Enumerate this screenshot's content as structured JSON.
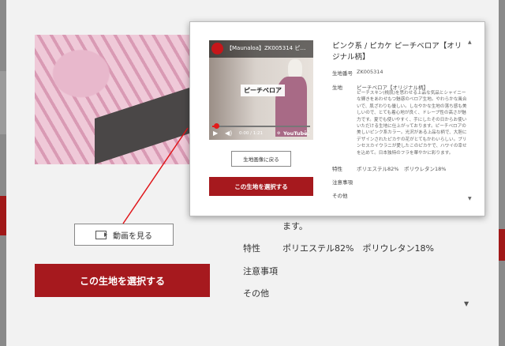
{
  "background_page": {
    "video_button_label": "動画を見る",
    "select_button_label": "この生地を選択する",
    "desc_tail": "ます。",
    "specs": [
      {
        "label": "特性",
        "value": "ポリエステル82%　ポリウレタン18%"
      },
      {
        "label": "注意事項",
        "value": ""
      },
      {
        "label": "その他",
        "value": ""
      }
    ]
  },
  "modal": {
    "title": "ピンク系 / ピカケ ピーチベロア【オリジナル柄】",
    "video": {
      "title": "【Maunaloa】ZK005314 ピ…",
      "overlay_label": "ピーチベロア",
      "time": "0:00 / 1:21",
      "youtube_label": "YouTube",
      "progress": 0.04
    },
    "back_button_label": "生地画像に戻る",
    "select_button_label": "この生地を選択する",
    "fields": [
      {
        "label": "生地番号",
        "value": "ZK005314"
      },
      {
        "label": "生地",
        "value": "ピーチベロア【オリジナル柄】"
      },
      {
        "label": "特性",
        "value": "ポリエステル82%　ポリウレタン18%"
      },
      {
        "label": "注意事項",
        "value": ""
      },
      {
        "label": "その他",
        "value": ""
      }
    ],
    "description": "ピーチスキン(桃肌)を思わせる上品な気品とシャイニーな輝きをあわせもつ魅惑のベロア生地。やわらかな風合いで、肌ざわりも優しい。しなやかな生地の落ち感も美しいので、とても着心地が良く、ドレープ性の高さが魅力です。夏でも使いやすく、手にしたその日からお使いいただける生地に仕上がっております。ピーチベロアの美しいピンク系カラー。光沢がある上品な柄で、大胆にデザインされたピカケの花がとてもかわいらしい。プリンセスカイウラニが愛したこのピカケで、ハワイの幸せを込めて。日本独特のフラを華やかに彩ります。"
  }
}
